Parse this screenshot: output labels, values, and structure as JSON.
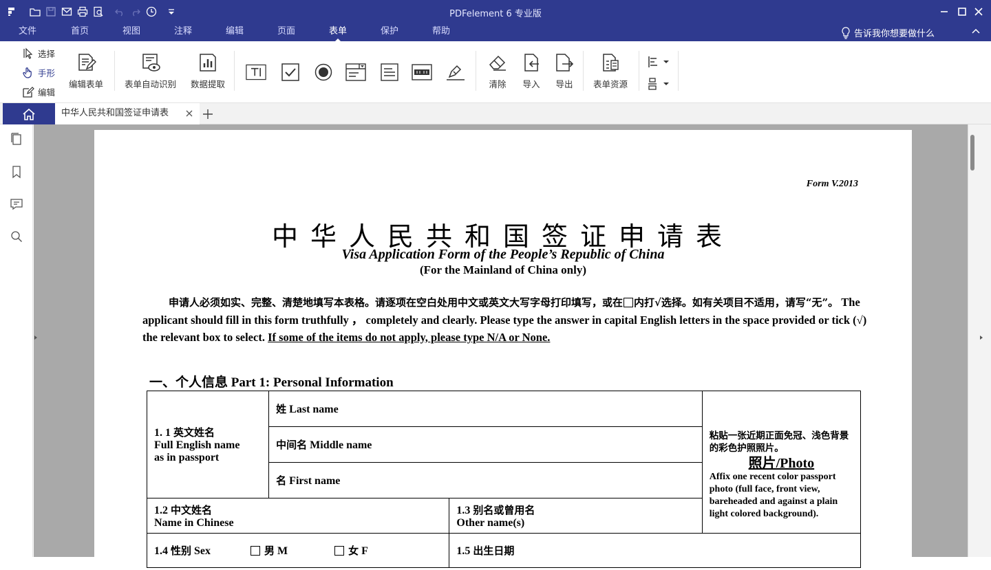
{
  "app": {
    "title": "PDFelement  6 专业版"
  },
  "menu": {
    "items": [
      "文件",
      "首页",
      "视图",
      "注释",
      "编辑",
      "页面",
      "表单",
      "保护",
      "帮助"
    ],
    "active": "表单",
    "tell_me": "告诉我你想要做什么"
  },
  "ribbon": {
    "select": "选择",
    "hand": "手形",
    "edit": "编辑",
    "edit_form": "编辑表单",
    "form_auto_recognize": "表单自动识别",
    "data_extract": "数据提取",
    "clear": "清除",
    "import": "导入",
    "export": "导出",
    "form_resources": "表单资源"
  },
  "tabs": {
    "document": "中华人民共和国签证申请表"
  },
  "document": {
    "form_version": "Form V.2013",
    "title_cn": "中华人民共和国签证申请表",
    "title_en": "Visa Application Form of the People’s Republic of China",
    "subtitle": "(For the Mainland of China only)",
    "intro_cn_1": "申请人必须如实、完整、清楚地填写本表格。请逐项在空白处用中文或英文大写字母打印填写，或在",
    "intro_cn_2": "内打√选择。如有关项目不适用，请写“无”。",
    "intro_en_1": "The applicant should fill in this form truthfully ， completely and clearly. Please type the answer in capital English letters in the space provided or tick (√) the relevant box to select.",
    "intro_en_2": "If some of the items do not apply, please type N/A or None.",
    "part1_cn": "一、个人信息",
    "part1_en": "Part 1: Personal Information",
    "f11_num": "1. 1",
    "f11_cn": "英文姓名",
    "f11_en1": "Full English name",
    "f11_en2": "as in passport",
    "last_name_cn": "姓",
    "last_name_en": "Last name",
    "middle_name_cn": "中间名",
    "middle_name_en": "Middle name",
    "first_name_cn": "名",
    "first_name_en": "First name",
    "photo_cn": "粘贴一张近期正面免冠、浅色背景的彩色护照照片。",
    "photo_title": "照片/Photo",
    "photo_en": "Affix one recent color passport photo (full face, front view, bareheaded and against a plain light colored background).",
    "f12_num": "1.2",
    "f12_cn": "中文姓名",
    "f12_en": "Name in Chinese",
    "f13_num": "1.3",
    "f13_cn": "别名或曾用名",
    "f13_en": "Other name(s)",
    "f14_num": "1.4",
    "f14_cn": "性别",
    "f14_en": "Sex",
    "male_cn": "男",
    "male_en": "M",
    "female_cn": "女",
    "female_en": "F",
    "f15_num": "1.5",
    "f15_cn": "出生日期"
  },
  "colors": {
    "accent": "#2f3a8f",
    "canvas": "#a9a9a9"
  }
}
